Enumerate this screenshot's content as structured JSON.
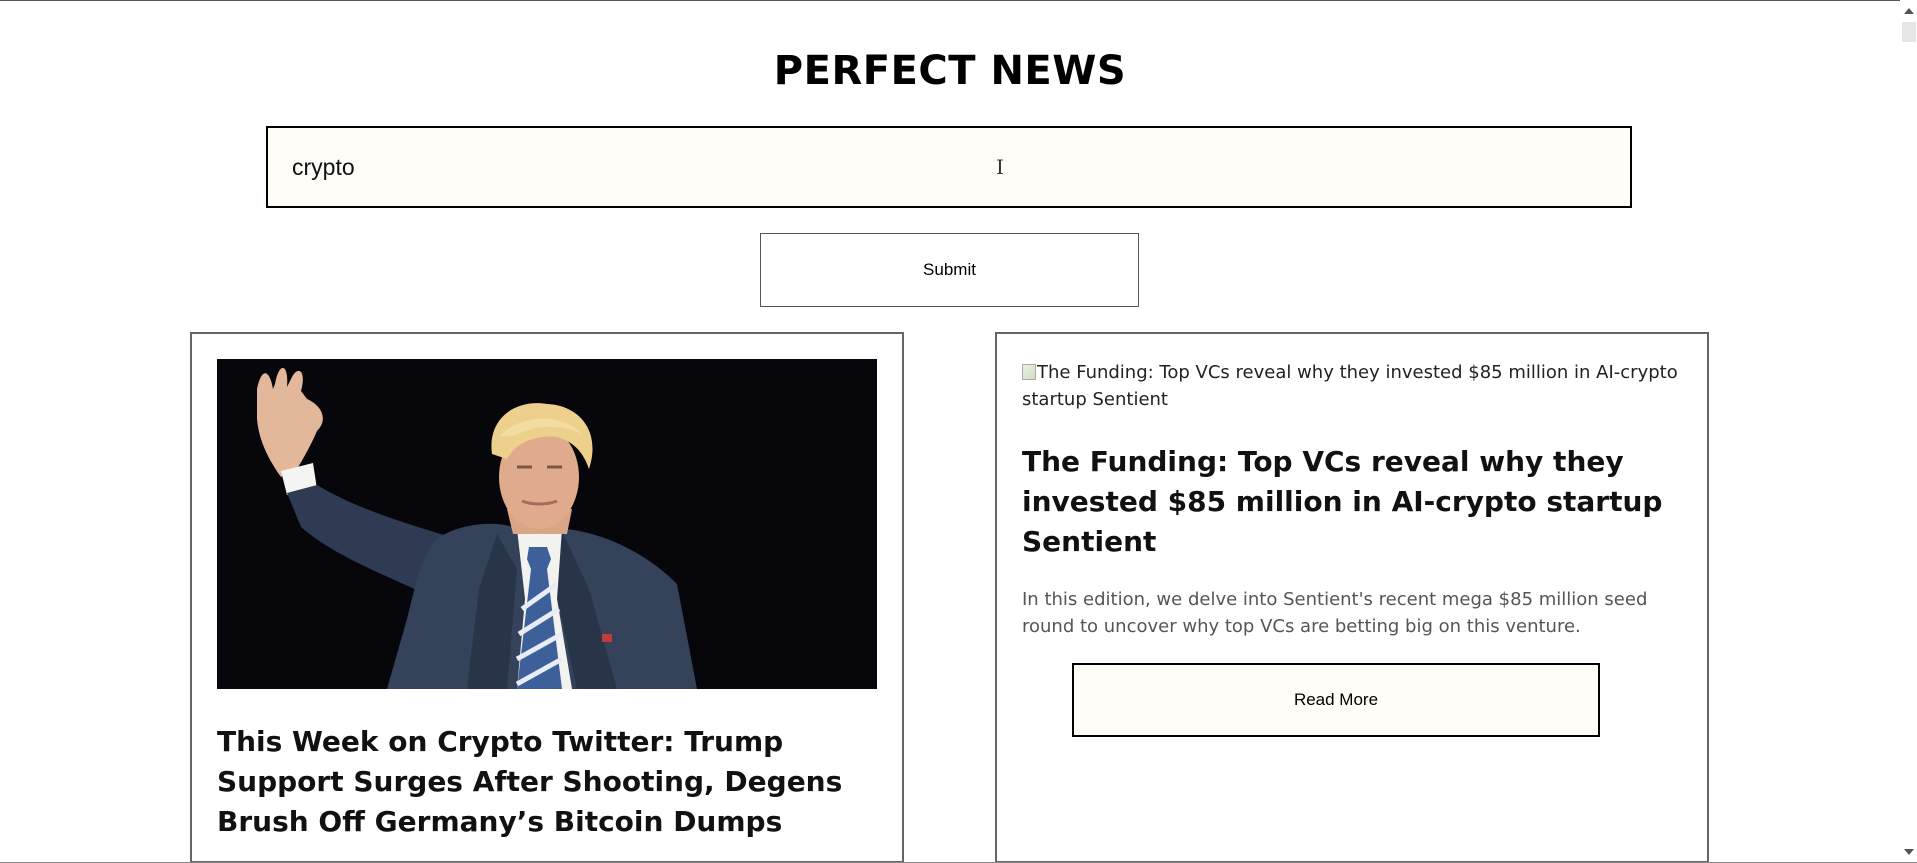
{
  "header": {
    "title": "PERFECT NEWS"
  },
  "search": {
    "value": "crypto",
    "submit_label": "Submit"
  },
  "articles": [
    {
      "title": "This Week on Crypto Twitter: Trump Support Surges After Shooting, Degens Brush Off Germany’s Bitcoin Dumps",
      "image_alt": "",
      "description": "",
      "read_more_label": ""
    },
    {
      "title": "The Funding: Top VCs reveal why they invested $85 million in AI-crypto startup Sentient",
      "image_alt": "The Funding: Top VCs reveal why they invested $85 million in AI-crypto startup Sentient",
      "description": "In this edition, we delve into Sentient's recent mega $85 million seed round to uncover why top VCs are betting big on this venture.",
      "read_more_label": "Read More"
    }
  ],
  "colors": {
    "input_background": "#fffdf8",
    "card_border": "#666666",
    "description_text": "#555555"
  }
}
